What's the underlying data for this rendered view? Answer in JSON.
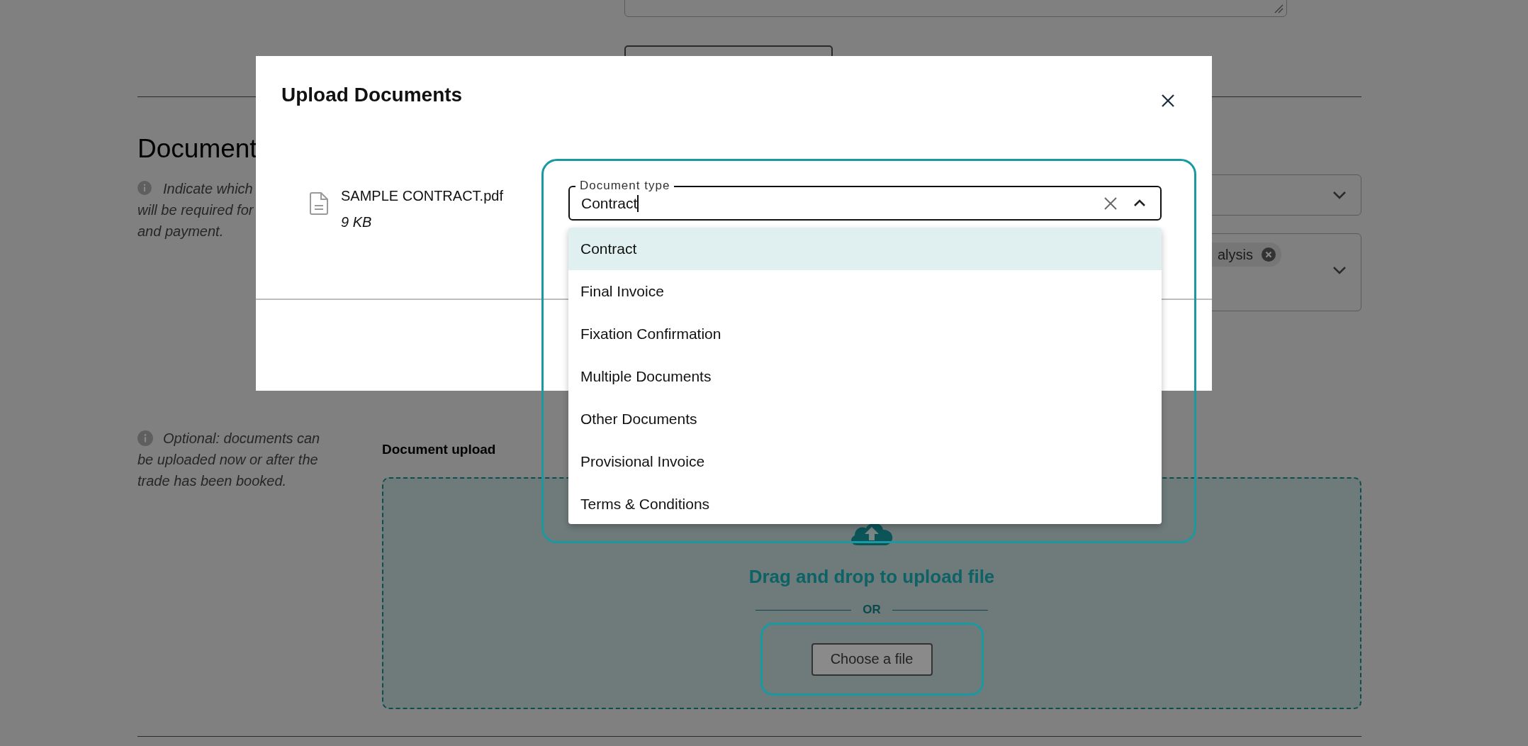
{
  "background": {
    "heading": "Document",
    "info_lines": [
      "Indicate which",
      "will be required for",
      "and payment."
    ],
    "chip": "alysis",
    "optional_note_lines": [
      "Optional: documents can",
      "be uploaded now or after the",
      "trade has been booked."
    ],
    "upload": {
      "label": "Document upload",
      "drop_text": "Drag and drop to upload file",
      "or": "OR",
      "button": "Choose a file"
    }
  },
  "dialog": {
    "title": "Upload Documents",
    "file": {
      "name": "SAMPLE CONTRACT.pdf",
      "size": "9 KB"
    },
    "field": {
      "label": "Document type",
      "value": "Contract"
    },
    "options": [
      {
        "label": "Contract",
        "selected": true
      },
      {
        "label": "Final Invoice",
        "selected": false
      },
      {
        "label": "Fixation Confirmation",
        "selected": false
      },
      {
        "label": "Multiple Documents",
        "selected": false
      },
      {
        "label": "Other Documents",
        "selected": false
      },
      {
        "label": "Provisional Invoice",
        "selected": false
      },
      {
        "label": "Terms & Conditions",
        "selected": false
      }
    ]
  }
}
